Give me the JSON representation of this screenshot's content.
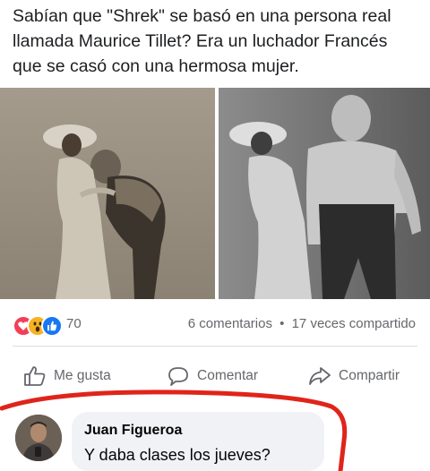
{
  "post": {
    "text": "Sabían que \"Shrek\" se basó en una persona real llamada Maurice Tillet? Era un luchador Francés que se casó con una hermosa mujer."
  },
  "photos": [
    {
      "name": "photo-couple-bent"
    },
    {
      "name": "photo-couple-standing"
    }
  ],
  "stats": {
    "reactions": [
      "love",
      "wow",
      "like"
    ],
    "reaction_count": "70",
    "comments": "6 comentarios",
    "separator": "•",
    "shares": "17 veces compartido"
  },
  "actions": {
    "like": "Me gusta",
    "comment": "Comentar",
    "share": "Compartir"
  },
  "comment": {
    "author": "Juan Figueroa",
    "text": "Y daba clases los jueves?"
  },
  "colors": {
    "love": "#f33e58",
    "wow": "#f7b125",
    "like": "#1877f2",
    "annotation": "#e0241b",
    "bubble": "#f0f2f5"
  }
}
